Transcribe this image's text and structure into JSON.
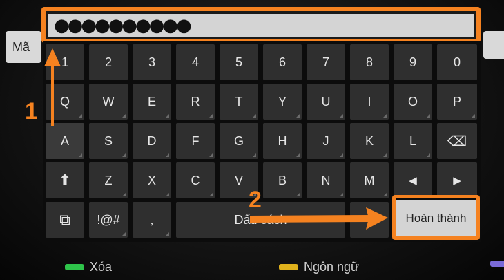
{
  "side_label": "Mã",
  "password_mask": "●●●●●●●●●●",
  "rows": [
    [
      "1",
      "2",
      "3",
      "4",
      "5",
      "6",
      "7",
      "8",
      "9",
      "0"
    ],
    [
      "Q",
      "W",
      "E",
      "R",
      "T",
      "Y",
      "U",
      "I",
      "O",
      "P"
    ],
    [
      "A",
      "S",
      "D",
      "F",
      "G",
      "H",
      "J",
      "K",
      "L"
    ],
    [
      "Z",
      "X",
      "C",
      "V",
      "B",
      "N",
      "M"
    ]
  ],
  "keys": {
    "backspace_icon": "⌫",
    "shift_icon": "⬆",
    "left_icon": "◀",
    "right_icon": "▶",
    "layout_icon": "⧉",
    "symbols": "!@#",
    "comma": ",",
    "space": "Dấu cách",
    "done": "Hoàn thành"
  },
  "annotations": {
    "one": "1",
    "two": "2"
  },
  "legend": {
    "green_label": "Xóa",
    "yellow_label": "Ngôn ngữ"
  },
  "colors": {
    "accent": "#f58220",
    "green": "#2ec44a",
    "yellow": "#e0b21c",
    "purple": "#7a6ad8"
  }
}
